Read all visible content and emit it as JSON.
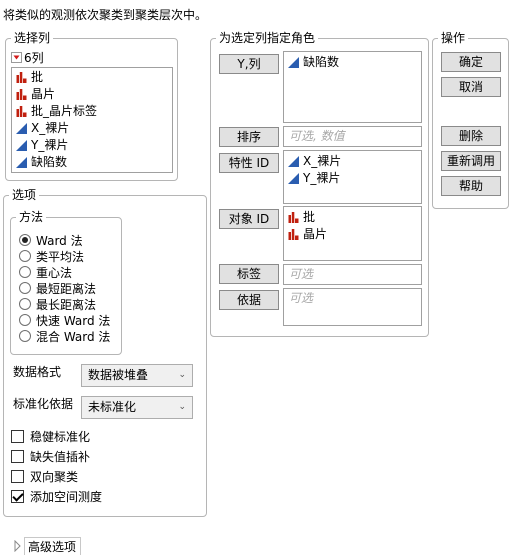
{
  "description": "将类似的观测依次聚类到聚类层次中。",
  "select_columns": {
    "title": "选择列",
    "count_label": "6列",
    "columns": [
      {
        "name": "批",
        "type": "nominal"
      },
      {
        "name": "晶片",
        "type": "nominal"
      },
      {
        "name": "批_晶片标签",
        "type": "nominal"
      },
      {
        "name": "X_裸片",
        "type": "continuous"
      },
      {
        "name": "Y_裸片",
        "type": "continuous"
      },
      {
        "name": "缺陷数",
        "type": "continuous"
      }
    ]
  },
  "roles": {
    "title": "为选定列指定角色",
    "y_columns": {
      "label": "Y,列",
      "items": [
        {
          "name": "缺陷数",
          "type": "continuous"
        }
      ]
    },
    "ordering": {
      "label": "排序",
      "placeholder": "可选, 数值"
    },
    "attribute_id": {
      "label": "特性 ID",
      "items": [
        {
          "name": "X_裸片",
          "type": "continuous"
        },
        {
          "name": "Y_裸片",
          "type": "continuous"
        }
      ]
    },
    "object_id": {
      "label": "对象 ID",
      "items": [
        {
          "name": "批",
          "type": "nominal"
        },
        {
          "name": "晶片",
          "type": "nominal"
        }
      ]
    },
    "label": {
      "label": "标签",
      "placeholder": "可选"
    },
    "by": {
      "label": "依据",
      "placeholder": "可选"
    }
  },
  "actions": {
    "title": "操作",
    "ok": "确定",
    "cancel": "取消",
    "remove": "删除",
    "recall": "重新调用",
    "help": "帮助"
  },
  "options": {
    "title": "选项",
    "method": {
      "title": "方法",
      "selected": "Ward 法",
      "choices": [
        "Ward 法",
        "类平均法",
        "重心法",
        "最短距离法",
        "最长距离法",
        "快速 Ward 法",
        "混合 Ward 法"
      ]
    },
    "data_format": {
      "label": "数据格式",
      "value": "数据被堆叠"
    },
    "standardize_by": {
      "label": "标准化依据",
      "value": "未标准化"
    },
    "checkboxes": [
      {
        "label": "稳健标准化",
        "checked": false
      },
      {
        "label": "缺失值插补",
        "checked": false
      },
      {
        "label": "双向聚类",
        "checked": false
      },
      {
        "label": "添加空间测度",
        "checked": true
      }
    ]
  },
  "advanced": {
    "label": "高级选项"
  },
  "colors": {
    "nominal_icon": "#c0200f",
    "continuous_icon": "#2a5db0",
    "disclosure_red": "#d11a1a"
  }
}
